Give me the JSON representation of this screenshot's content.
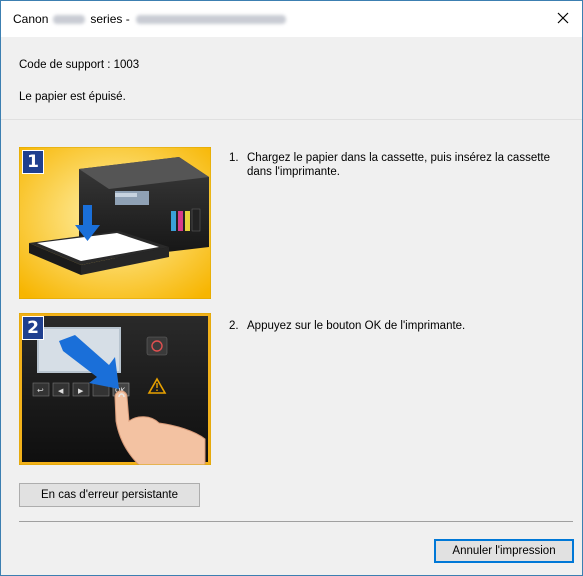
{
  "window": {
    "title_prefix": "Canon",
    "title_series": "series -"
  },
  "message": {
    "support_code": "Code de support : 1003",
    "description": "Le papier est épuisé."
  },
  "steps": [
    {
      "badge": "1",
      "number": "1.",
      "text": "Chargez le papier dans la cassette, puis insérez la cassette dans l'imprimante."
    },
    {
      "badge": "2",
      "number": "2.",
      "text": "Appuyez sur le bouton OK de l'imprimante."
    }
  ],
  "panel": {
    "ok_key": "OK"
  },
  "buttons": {
    "persistent_error": "En cas d'erreur persistante",
    "cancel_print": "Annuler l'impression"
  },
  "colors": {
    "accent": "#0078d7",
    "badge": "#1f3f8f",
    "arrow": "#1a6fd9",
    "image_bg": "#f7c227",
    "warning": "#e8a100"
  }
}
